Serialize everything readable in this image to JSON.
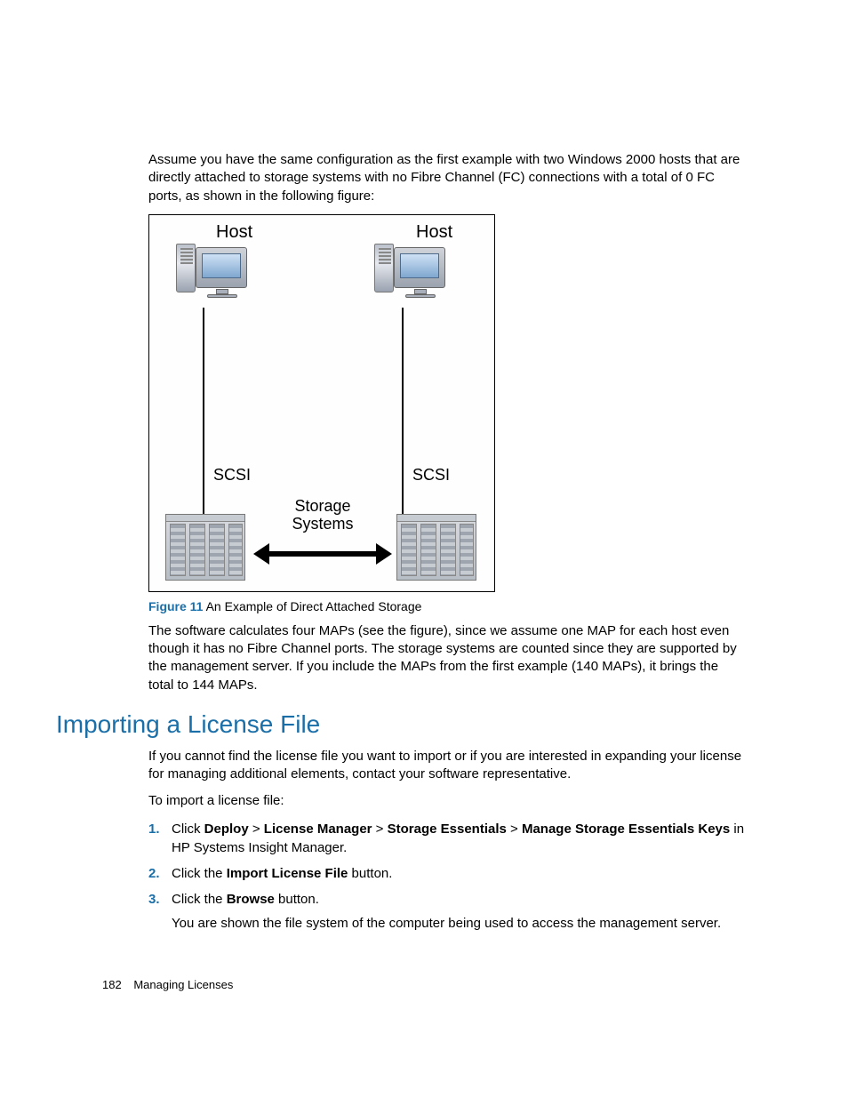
{
  "intro": "Assume you have the same configuration as the first example with two Windows 2000 hosts that are directly attached to storage systems with no Fibre Channel (FC) connections with a total of 0 FC ports, as shown in the following figure:",
  "diagram": {
    "host_label_left": "Host",
    "host_label_right": "Host",
    "scsi_left": "SCSI",
    "scsi_right": "SCSI",
    "storage_label": "Storage Systems"
  },
  "figure": {
    "num": "Figure 11",
    "caption": "An Example of Direct Attached Storage"
  },
  "para2": "The software calculates four MAPs (see the figure), since we assume one MAP for each host even though it has no Fibre Channel ports. The storage systems are counted since they are supported by the management server. If you include the MAPs from the first example (140 MAPs), it brings the total to 144 MAPs.",
  "heading": "Importing a License File",
  "para3": "If you cannot find the license file you want to import or if you are interested in expanding your license for managing additional elements, contact your software representative.",
  "para4": "To import a license file:",
  "steps": [
    {
      "n": "1.",
      "pre": "Click ",
      "b1": "Deploy",
      "g1": " > ",
      "b2": "License Manager",
      "g2": " > ",
      "b3": "Storage Essentials",
      "g3": " > ",
      "b4": "Manage Storage Essentials Keys",
      "post": " in HP Systems Insight Manager."
    },
    {
      "n": "2.",
      "pre": "Click the ",
      "b1": "Import License File",
      "post": " button."
    },
    {
      "n": "3.",
      "pre": "Click the ",
      "b1": "Browse",
      "post": " button.",
      "sub": "You are shown the file system of the computer being used to access the management server."
    }
  ],
  "footer": {
    "page": "182",
    "title": "Managing Licenses"
  }
}
